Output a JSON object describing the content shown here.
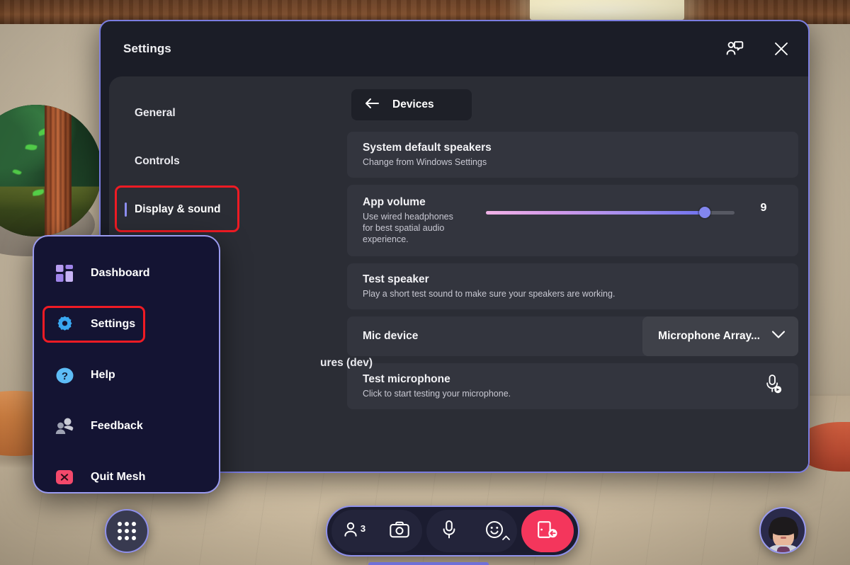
{
  "window": {
    "title": "Settings",
    "feedback_icon": "person-speech-bubble-icon",
    "close_icon": "close-icon"
  },
  "sidebar": {
    "items": [
      {
        "label": "General",
        "active": false,
        "highlighted": false
      },
      {
        "label": "Controls",
        "active": false,
        "highlighted": false
      },
      {
        "label": "Display & sound",
        "active": true,
        "highlighted": true
      }
    ],
    "obscured_item_fragment": "ures (dev)"
  },
  "main": {
    "header": {
      "back_icon": "arrow-left-icon",
      "label": "Devices",
      "highlighted": true
    },
    "rows": [
      {
        "id": "system-default-speakers",
        "title": "System default speakers",
        "subtitle": "Change from Windows Settings"
      },
      {
        "id": "app-volume",
        "title": "App volume",
        "subtitle": "Use wired headphones for best spatial audio experience.",
        "value": "9",
        "slider_percent": 88
      },
      {
        "id": "test-speaker",
        "title": "Test speaker",
        "subtitle": "Play a short test sound to make sure your speakers are working."
      },
      {
        "id": "mic-device",
        "title": "Mic device",
        "dropdown_value": "Microphone Array...",
        "dropdown_icon": "chevron-down-icon"
      },
      {
        "id": "test-microphone",
        "title": "Test microphone",
        "subtitle": "Click to start testing your microphone.",
        "action_icon": "microphone-test-icon"
      }
    ]
  },
  "context_menu": {
    "items": [
      {
        "label": "Dashboard",
        "icon": "dashboard-icon",
        "highlighted": false
      },
      {
        "label": "Settings",
        "icon": "gear-icon",
        "highlighted": true
      },
      {
        "label": "Help",
        "icon": "help-question-icon",
        "highlighted": false
      },
      {
        "label": "Feedback",
        "icon": "people-feedback-icon",
        "highlighted": false
      },
      {
        "label": "Quit Mesh",
        "icon": "quit-x-icon",
        "highlighted": false
      }
    ]
  },
  "taskbar": {
    "apps_button_icon": "apps-grid-icon",
    "participants": {
      "icon": "person-icon",
      "count": "3"
    },
    "camera": {
      "icon": "camera-icon"
    },
    "microphone": {
      "icon": "microphone-icon"
    },
    "reactions": {
      "icon": "emoji-smiley-icon",
      "caret_icon": "chevron-up-icon"
    },
    "leave": {
      "icon": "leave-call-icon"
    },
    "avatar": {
      "icon": "avatar-icon"
    }
  },
  "colors": {
    "window_border": "#7b7de0",
    "window_bg": "#1b1d27",
    "panel_bg": "#2b2d35",
    "row_bg": "#33353e",
    "highlight_red": "#ef1b24",
    "accent_purple": "#8d8ef0",
    "slider_start": "#f0b2e6",
    "slider_end": "#6f72ee",
    "leave_red": "#f4365c"
  }
}
